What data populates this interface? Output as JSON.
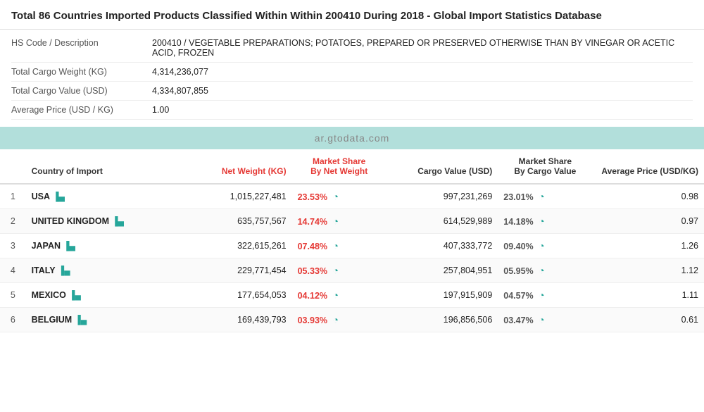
{
  "header": {
    "title_prefix": "Total 86 Countries Imported Products Classified Within Within 200410 During 2018",
    "title_suffix": " - Global Import Statistics Database",
    "hs_label": "HS Code / Description",
    "hs_value": "200410 / VEGETABLE PREPARATIONS; POTATOES, PREPARED OR PRESERVED OTHERWISE THAN BY VINEGAR OR ACETIC ACID, FROZEN",
    "weight_label": "Total Cargo Weight (KG)",
    "weight_value": "4,314,236,077",
    "value_label": "Total Cargo Value (USD)",
    "value_value": "4,334,807,855",
    "avg_label": "Average Price (USD / KG)",
    "avg_value": "1.00"
  },
  "watermark": "ar.gtodata.com",
  "columns": {
    "index": "#",
    "country": "Country of Import",
    "net_weight": "Net Weight (KG)",
    "market_share_weight": "Market Share By Net Weight",
    "cargo_value": "Cargo Value (USD)",
    "market_share_value": "Market Share By Cargo Value",
    "avg_price": "Average Price (USD/KG)"
  },
  "rows": [
    {
      "rank": 1,
      "country": "USA",
      "net_weight": "1,015,227,481",
      "market_share_weight": "23.53%",
      "cargo_value": "997,231,269",
      "market_share_value": "23.01%",
      "avg_price": "0.98"
    },
    {
      "rank": 2,
      "country": "UNITED KINGDOM",
      "net_weight": "635,757,567",
      "market_share_weight": "14.74%",
      "cargo_value": "614,529,989",
      "market_share_value": "14.18%",
      "avg_price": "0.97"
    },
    {
      "rank": 3,
      "country": "JAPAN",
      "net_weight": "322,615,261",
      "market_share_weight": "07.48%",
      "cargo_value": "407,333,772",
      "market_share_value": "09.40%",
      "avg_price": "1.26"
    },
    {
      "rank": 4,
      "country": "ITALY",
      "net_weight": "229,771,454",
      "market_share_weight": "05.33%",
      "cargo_value": "257,804,951",
      "market_share_value": "05.95%",
      "avg_price": "1.12"
    },
    {
      "rank": 5,
      "country": "MEXICO",
      "net_weight": "177,654,053",
      "market_share_weight": "04.12%",
      "cargo_value": "197,915,909",
      "market_share_value": "04.57%",
      "avg_price": "1.11"
    },
    {
      "rank": 6,
      "country": "BELGIUM",
      "net_weight": "169,439,793",
      "market_share_weight": "03.93%",
      "cargo_value": "196,856,506",
      "market_share_value": "03.47%",
      "avg_price": "0.61"
    }
  ]
}
